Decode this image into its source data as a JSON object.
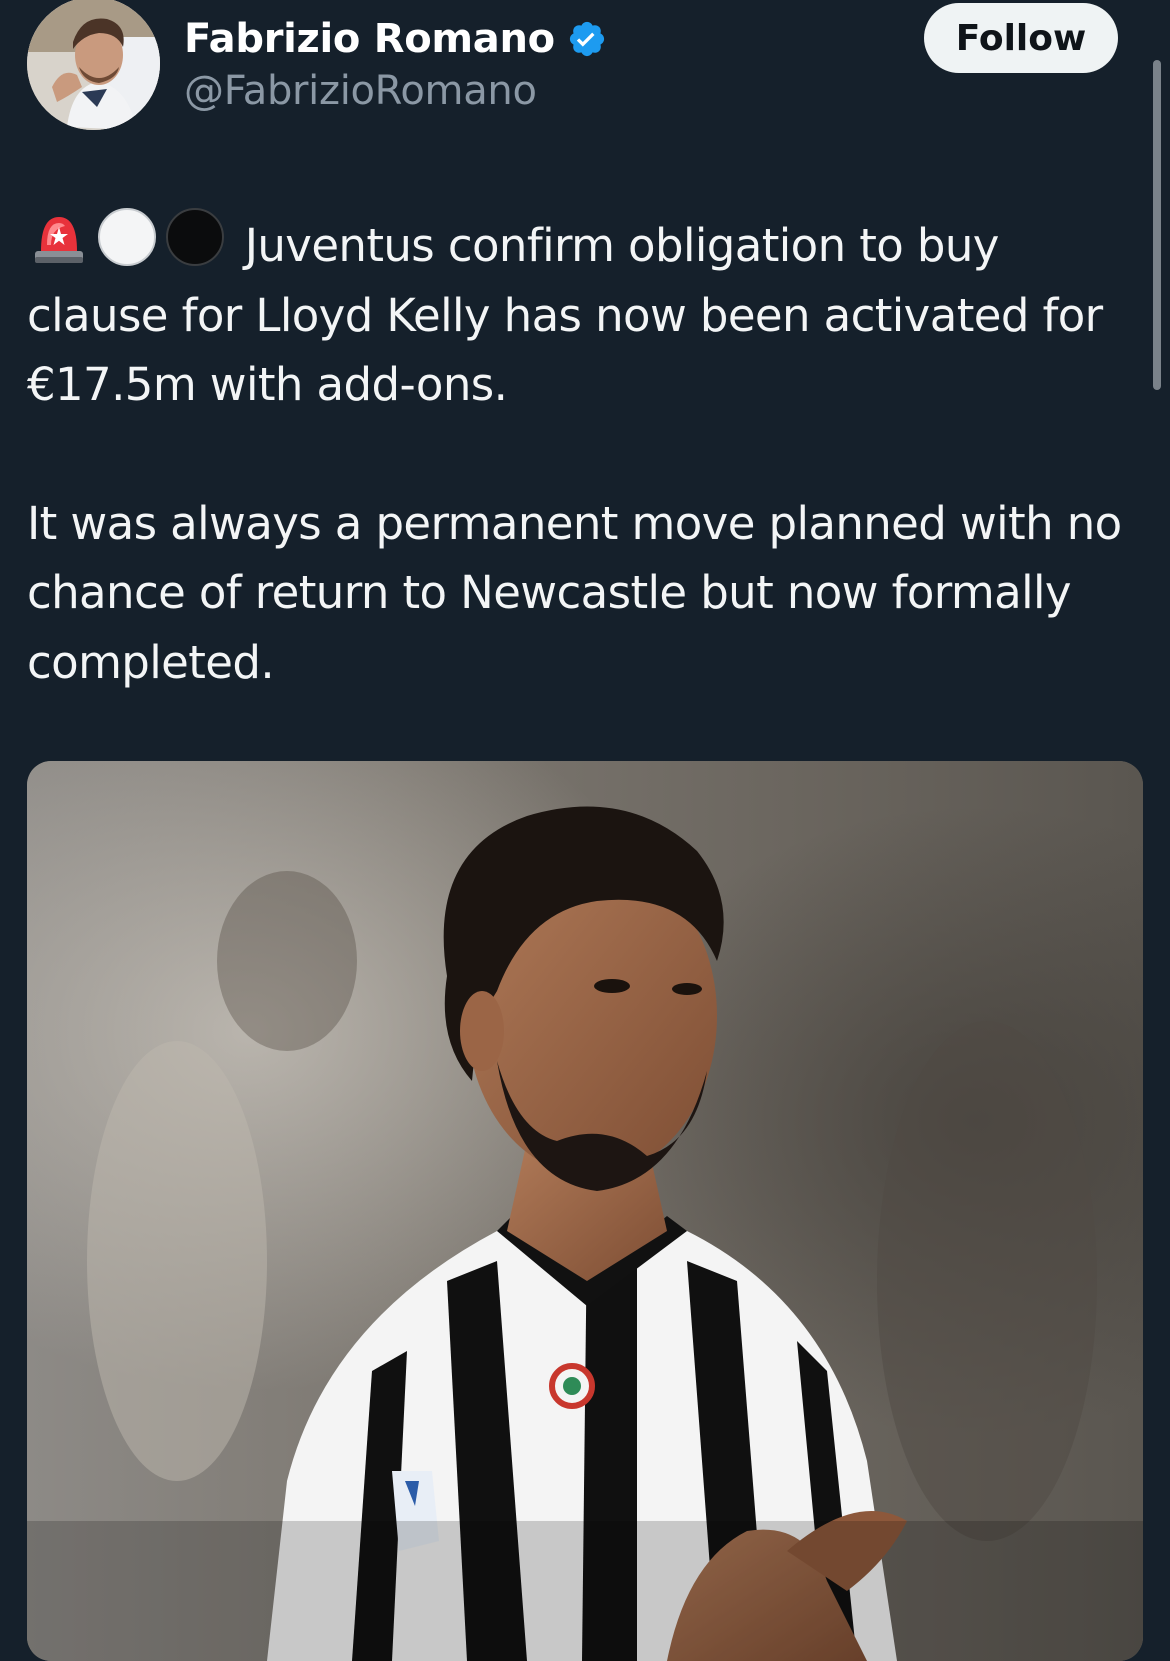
{
  "author": {
    "name": "Fabrizio Romano",
    "handle": "@FabrizioRomano",
    "verified": true,
    "avatar_icon": "profile-photo"
  },
  "follow_button": {
    "label": "Follow"
  },
  "tweet": {
    "emojis": [
      "police-light-icon",
      "white-circle-icon",
      "black-circle-icon"
    ],
    "paragraph_1": "Juventus confirm obligation to buy clause for Lloyd Kelly has now been activated for €17.5m with add-ons.",
    "paragraph_2": "It was always a permanent move planned with no chance of return to Newcastle but now formally completed."
  },
  "media": {
    "type": "photo",
    "subject": "football-player-in-striped-jersey"
  },
  "colors": {
    "background": "#15202b",
    "verified_blue": "#1d9bf0",
    "follow_bg": "#eff3f4"
  }
}
